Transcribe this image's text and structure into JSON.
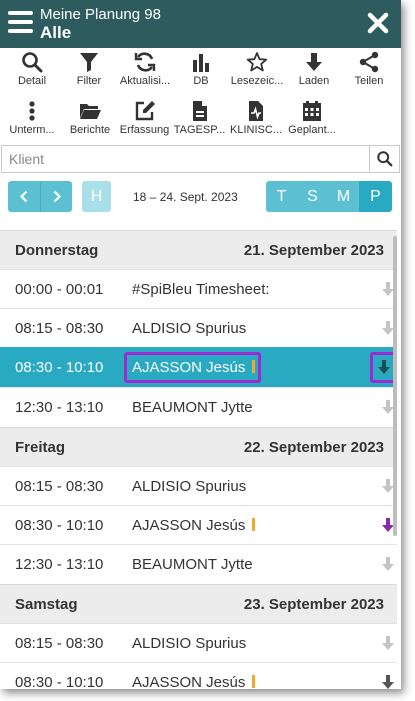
{
  "header": {
    "title_line1": "Meine Planung 98",
    "title_line2": "Alle"
  },
  "toolbar": {
    "row1": [
      {
        "label": "Detail",
        "icon": "search-icon"
      },
      {
        "label": "Filter",
        "icon": "filter-icon"
      },
      {
        "label": "Aktualisi...",
        "icon": "refresh-icon"
      },
      {
        "label": "DB",
        "icon": "bar-chart-icon"
      },
      {
        "label": "Lesezeic...",
        "icon": "star-icon"
      },
      {
        "label": "Laden",
        "icon": "download-arrow-icon"
      },
      {
        "label": "Teilen",
        "icon": "share-icon"
      }
    ],
    "row2": [
      {
        "label": "Unterm...",
        "icon": "more-vertical-icon"
      },
      {
        "label": "Berichte",
        "icon": "folder-icon"
      },
      {
        "label": "Erfassung",
        "icon": "edit-icon"
      },
      {
        "label": "TAGESP...",
        "icon": "document-icon"
      },
      {
        "label": "KLINISC...",
        "icon": "medical-document-icon"
      },
      {
        "label": "Geplant...",
        "icon": "calendar-icon"
      }
    ]
  },
  "search": {
    "placeholder": "Klient"
  },
  "nav": {
    "today_label": "H",
    "date_range": "18 – 24. Sept. 2023",
    "views": [
      "T",
      "S",
      "M",
      "P"
    ],
    "active_view": "P"
  },
  "days": [
    {
      "name": "Donnerstag",
      "date": "21. September 2023",
      "entries": [
        {
          "time": "00:00 - 00:01",
          "client": "#SpiBleu Timesheet:",
          "marker": false
        },
        {
          "time": "08:15 - 08:30",
          "client": "ALDISIO Spurius",
          "marker": false
        },
        {
          "time": "08:30 - 10:10",
          "client": "AJASSON Jesús",
          "marker": true,
          "selected": true
        },
        {
          "time": "12:30 - 13:10",
          "client": "BEAUMONT Jytte",
          "marker": false
        }
      ]
    },
    {
      "name": "Freitag",
      "date": "22. September 2023",
      "entries": [
        {
          "time": "08:15 - 08:30",
          "client": "ALDISIO Spurius",
          "marker": false
        },
        {
          "time": "08:30 - 10:10",
          "client": "AJASSON Jesús",
          "marker": true
        },
        {
          "time": "12:30 - 13:10",
          "client": "BEAUMONT Jytte",
          "marker": false
        }
      ]
    },
    {
      "name": "Samstag",
      "date": "23. September 2023",
      "entries": [
        {
          "time": "08:15 - 08:30",
          "client": "ALDISIO Spurius",
          "marker": false
        },
        {
          "time": "08:30 - 10:10",
          "client": "AJASSON Jesús",
          "marker": true
        }
      ]
    }
  ],
  "colors": {
    "header_bg": "#2e5c5e",
    "accent": "#2aa9c2",
    "nav_button": "#5cc0d2",
    "highlight_outline": "#9b2bd1",
    "marker": "#f2a82a"
  }
}
